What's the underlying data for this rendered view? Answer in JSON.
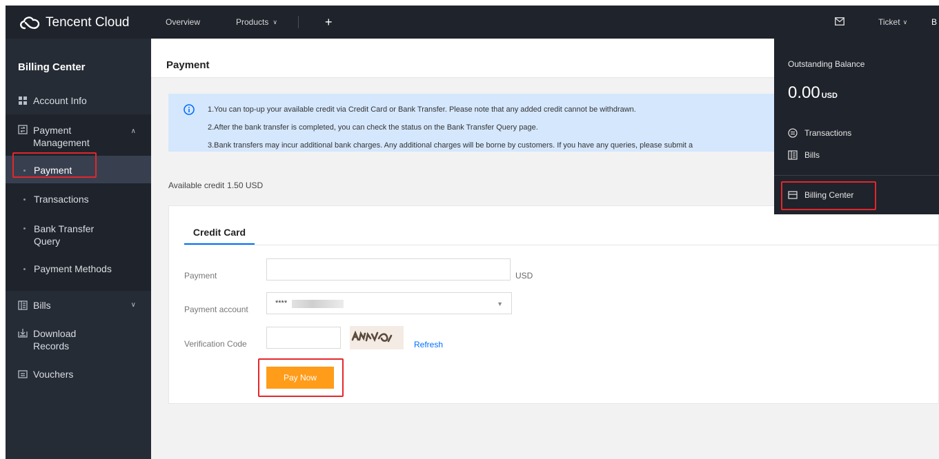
{
  "topbar": {
    "brand": "Tencent Cloud",
    "nav_overview": "Overview",
    "nav_products": "Products",
    "nav_plus": "+",
    "nav_ticket": "Ticket",
    "nav_b": "B"
  },
  "sidebar": {
    "title": "Billing Center",
    "account_info": "Account Info",
    "payment_management_1": "Payment",
    "payment_management_2": "Management",
    "payment": "Payment",
    "transactions": "Transactions",
    "bank_transfer_1": "Bank Transfer",
    "bank_transfer_2": "Query",
    "payment_methods": "Payment Methods",
    "bills": "Bills",
    "download_1": "Download",
    "download_2": "Records",
    "vouchers": "Vouchers"
  },
  "page": {
    "title": "Payment",
    "notice_1": "1.You can top-up your available credit via Credit Card or Bank Transfer. Please note that any added credit cannot be withdrawn.",
    "notice_2": "2.After the bank transfer is completed, you can check the status on the Bank Transfer Query page.",
    "notice_3": "3.Bank transfers may incur additional bank charges. Any additional charges will be borne by customers. If you have any queries, please submit a",
    "available_label": "Available credit",
    "available_value": "1.50 USD"
  },
  "form": {
    "tab": "Credit Card",
    "payment_label": "Payment",
    "payment_value": "",
    "unit": "USD",
    "account_label": "Payment account",
    "account_value": "****",
    "code_label": "Verification Code",
    "code_value": "",
    "refresh": "Refresh",
    "pay_now": "Pay Now"
  },
  "balance": {
    "title": "Outstanding Balance",
    "amount": "0.00",
    "unit": "USD",
    "transactions": "Transactions",
    "bills": "Bills",
    "billing_center": "Billing Center"
  },
  "colors": {
    "accent": "#006eff",
    "pay_button": "#ff9c19",
    "highlight": "#e5262b",
    "sidebar": "#262c35",
    "topbar": "#1f232b"
  }
}
